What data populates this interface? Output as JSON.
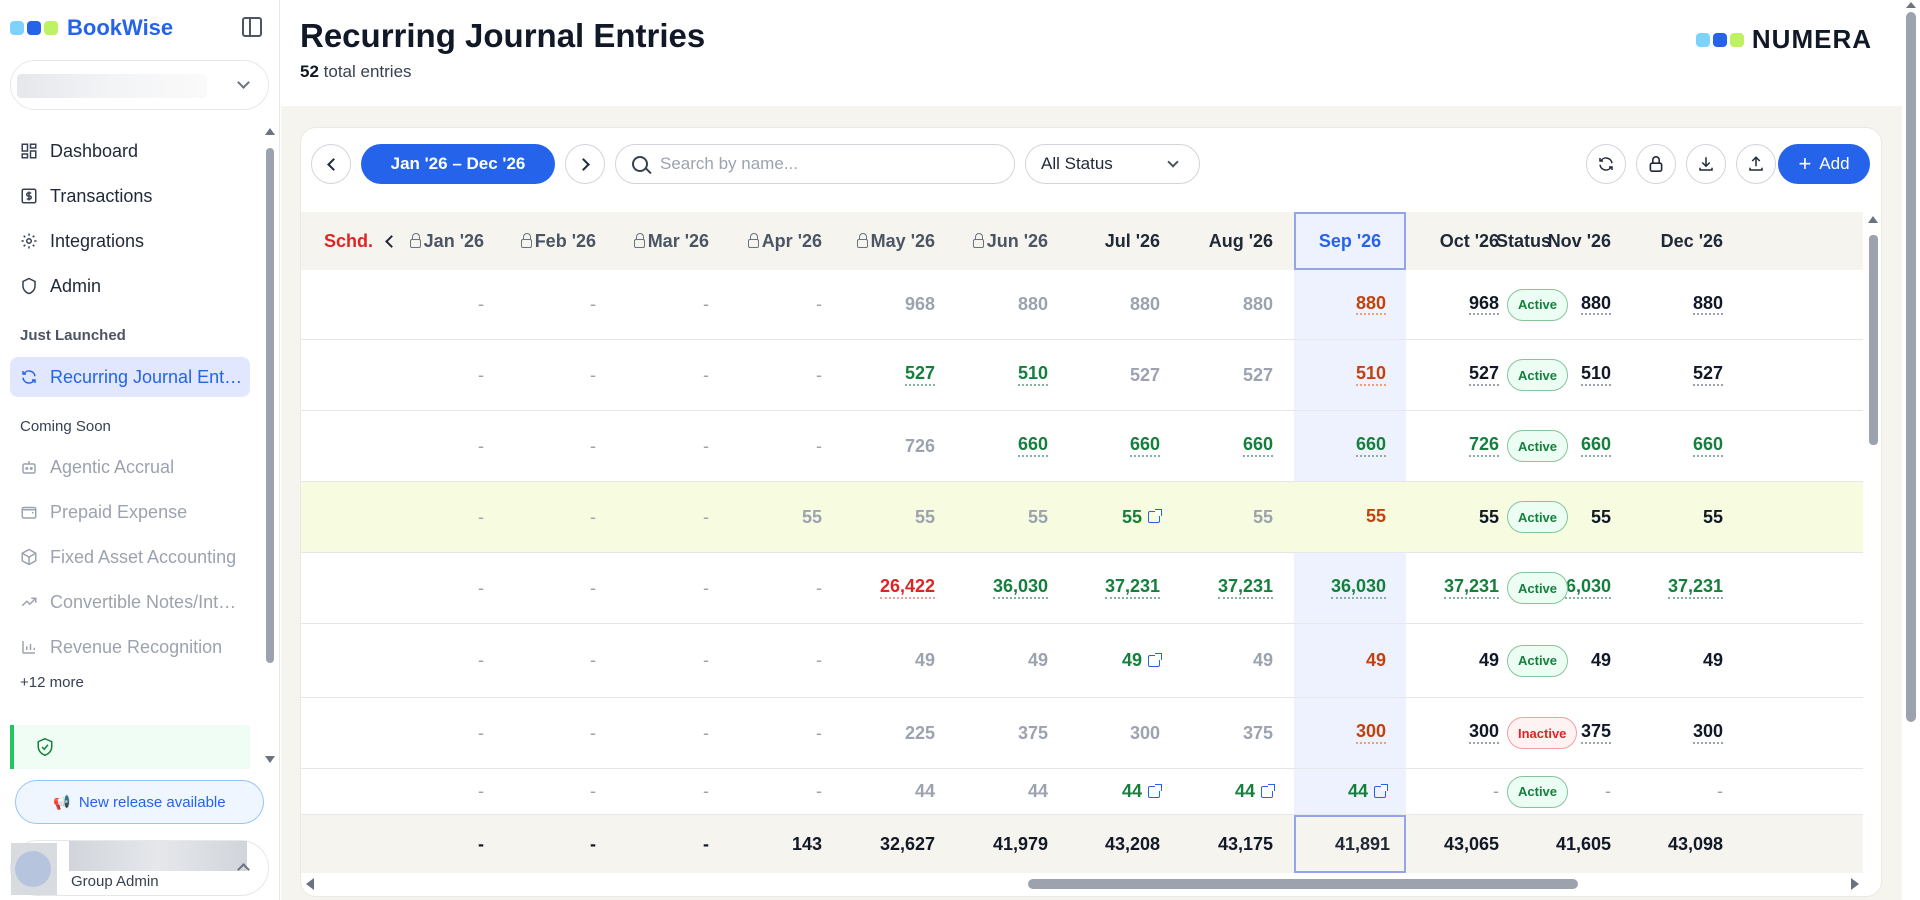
{
  "brand": {
    "name": "BookWise",
    "dot_colors": [
      "#7dd3fc",
      "#2563eb",
      "#bef264"
    ]
  },
  "sidebar": {
    "nav": [
      {
        "label": "Dashboard",
        "icon": "dashboard-icon"
      },
      {
        "label": "Transactions",
        "icon": "dollar-icon"
      },
      {
        "label": "Integrations",
        "icon": "gear-icon"
      },
      {
        "label": "Admin",
        "icon": "shield-icon"
      }
    ],
    "just_launched_label": "Just Launched",
    "active_item": {
      "label": "Recurring Journal Ent…",
      "icon": "refresh-icon"
    },
    "coming_soon_label": "Coming Soon",
    "coming_soon": [
      {
        "label": "Agentic Accrual",
        "icon": "bot-icon"
      },
      {
        "label": "Prepaid Expense",
        "icon": "wallet-icon"
      },
      {
        "label": "Fixed Asset Accounting",
        "icon": "box-icon"
      },
      {
        "label": "Convertible Notes/Int…",
        "icon": "trend-icon"
      },
      {
        "label": "Revenue Recognition",
        "icon": "bar-chart-icon"
      }
    ],
    "more_label": "+12 more",
    "release_label": "New release available",
    "user_role": "Group Admin"
  },
  "header": {
    "title": "Recurring Journal Entries",
    "count": "52",
    "count_suffix": "total entries",
    "partner_logo": "NUMERA"
  },
  "toolbar": {
    "range_label": "Jan '26 – Dec '26",
    "search_placeholder": "Search by name...",
    "status_filter": "All Status",
    "add_label": "Add"
  },
  "table": {
    "schd_label": "Schd.",
    "status_header": "Status",
    "months": [
      "Jan '26",
      "Feb '26",
      "Mar '26",
      "Apr '26",
      "May '26",
      "Jun '26",
      "Jul '26",
      "Aug '26",
      "Sep '26",
      "Oct '26",
      "Nov '26",
      "Dec '26"
    ],
    "locked_months": [
      true,
      true,
      true,
      true,
      true,
      true,
      false,
      false,
      false,
      false,
      false,
      false
    ],
    "selected_month": "Sep '26",
    "rows": [
      {
        "cells": [
          [
            "-",
            "d"
          ],
          [
            "-",
            "d"
          ],
          [
            "-",
            "d"
          ],
          [
            "-",
            "d"
          ],
          [
            "968",
            "g"
          ],
          [
            "880",
            "g"
          ],
          [
            "880",
            "g"
          ],
          [
            "880",
            "g"
          ],
          [
            "880",
            "o"
          ],
          [
            "968",
            "k"
          ],
          [
            "880",
            "k"
          ],
          [
            "880",
            "k"
          ]
        ],
        "status": "Active"
      },
      {
        "cells": [
          [
            "-",
            "d"
          ],
          [
            "-",
            "d"
          ],
          [
            "-",
            "d"
          ],
          [
            "-",
            "d"
          ],
          [
            "527",
            "n"
          ],
          [
            "510",
            "n"
          ],
          [
            "527",
            "g"
          ],
          [
            "527",
            "g"
          ],
          [
            "510",
            "o"
          ],
          [
            "527",
            "k"
          ],
          [
            "510",
            "k"
          ],
          [
            "527",
            "k"
          ]
        ],
        "status": "Active"
      },
      {
        "cells": [
          [
            "-",
            "d"
          ],
          [
            "-",
            "d"
          ],
          [
            "-",
            "d"
          ],
          [
            "-",
            "d"
          ],
          [
            "726",
            "g"
          ],
          [
            "660",
            "n"
          ],
          [
            "660",
            "n"
          ],
          [
            "660",
            "n"
          ],
          [
            "660",
            "n"
          ],
          [
            "726",
            "n"
          ],
          [
            "660",
            "n"
          ],
          [
            "660",
            "n"
          ]
        ],
        "status": "Active"
      },
      {
        "cells": [
          [
            "-",
            "d"
          ],
          [
            "-",
            "d"
          ],
          [
            "-",
            "d"
          ],
          [
            "55",
            "g"
          ],
          [
            "55",
            "g"
          ],
          [
            "55",
            "g"
          ],
          [
            "55",
            "np"
          ],
          [
            "55",
            "g"
          ],
          [
            "55",
            "op"
          ],
          [
            "55",
            "kp"
          ],
          [
            "55",
            "kp"
          ],
          [
            "55",
            "kp"
          ]
        ],
        "status": "Active",
        "highlight": true
      },
      {
        "cells": [
          [
            "-",
            "d"
          ],
          [
            "-",
            "d"
          ],
          [
            "-",
            "d"
          ],
          [
            "-",
            "d"
          ],
          [
            "26,422",
            "r"
          ],
          [
            "36,030",
            "n"
          ],
          [
            "37,231",
            "n"
          ],
          [
            "37,231",
            "n"
          ],
          [
            "36,030",
            "n"
          ],
          [
            "37,231",
            "n"
          ],
          [
            "36,030",
            "n"
          ],
          [
            "37,231",
            "n"
          ]
        ],
        "status": "Active"
      },
      {
        "cells": [
          [
            "-",
            "d"
          ],
          [
            "-",
            "d"
          ],
          [
            "-",
            "d"
          ],
          [
            "-",
            "d"
          ],
          [
            "49",
            "g"
          ],
          [
            "49",
            "g"
          ],
          [
            "49",
            "np"
          ],
          [
            "49",
            "g"
          ],
          [
            "49",
            "op"
          ],
          [
            "49",
            "kp"
          ],
          [
            "49",
            "kp"
          ],
          [
            "49",
            "kp"
          ]
        ],
        "status": "Active"
      },
      {
        "cells": [
          [
            "-",
            "d"
          ],
          [
            "-",
            "d"
          ],
          [
            "-",
            "d"
          ],
          [
            "-",
            "d"
          ],
          [
            "225",
            "g"
          ],
          [
            "375",
            "g"
          ],
          [
            "300",
            "g"
          ],
          [
            "375",
            "g"
          ],
          [
            "300",
            "o"
          ],
          [
            "300",
            "k"
          ],
          [
            "375",
            "k"
          ],
          [
            "300",
            "k"
          ]
        ],
        "status": "Inactive"
      },
      {
        "cells": [
          [
            "-",
            "d"
          ],
          [
            "-",
            "d"
          ],
          [
            "-",
            "d"
          ],
          [
            "-",
            "d"
          ],
          [
            "44",
            "g"
          ],
          [
            "44",
            "g"
          ],
          [
            "44",
            "np"
          ],
          [
            "44",
            "np"
          ],
          [
            "44",
            "np"
          ],
          [
            "-",
            "d"
          ],
          [
            "-",
            "d"
          ],
          [
            "-",
            "d"
          ]
        ],
        "status": "Active"
      }
    ],
    "link_cells": [
      "3-6",
      "5-6",
      "7-6",
      "7-7",
      "7-8"
    ],
    "totals": [
      "-",
      "-",
      "-",
      "143",
      "32,627",
      "41,979",
      "43,208",
      "43,175",
      "41,891",
      "43,065",
      "41,605",
      "43,098"
    ]
  }
}
